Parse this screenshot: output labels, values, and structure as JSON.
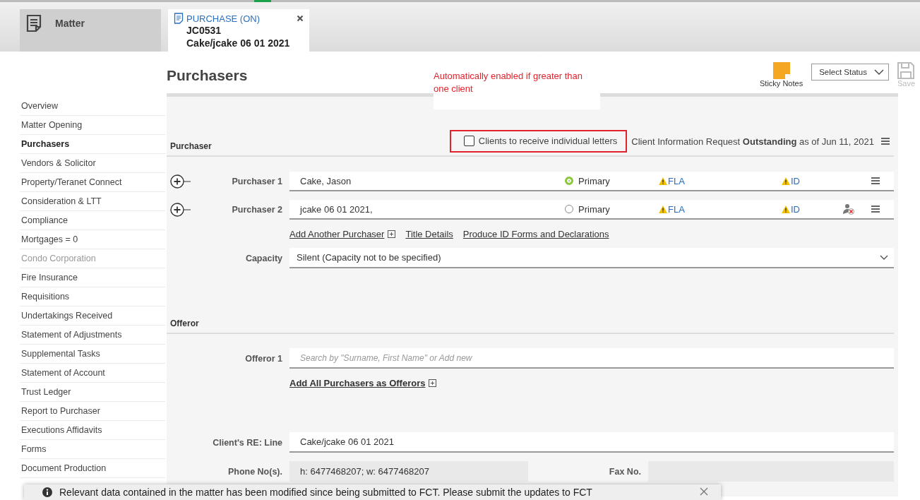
{
  "header": {
    "module": "Matter",
    "tab": {
      "type": "PURCHASE (ON)",
      "number": "JC0531",
      "name": "Cake/jcake 06 01 2021"
    }
  },
  "page_title": "Purchasers",
  "annotation": "Automatically enabled if greater than one client",
  "toolbar": {
    "sticky_notes": "Sticky Notes",
    "status_select": "Select Status",
    "save": {
      "label": "Save",
      "disabled": true
    }
  },
  "sidebar": [
    {
      "label": "Overview",
      "selected": false,
      "disabled": false
    },
    {
      "label": "Matter Opening",
      "selected": false,
      "disabled": false
    },
    {
      "label": "Purchasers",
      "selected": true,
      "disabled": false
    },
    {
      "label": "Vendors & Solicitor",
      "selected": false,
      "disabled": false
    },
    {
      "label": "Property/Teranet Connect",
      "selected": false,
      "disabled": false
    },
    {
      "label": "Consideration & LTT",
      "selected": false,
      "disabled": false
    },
    {
      "label": "Compliance",
      "selected": false,
      "disabled": false
    },
    {
      "label": "Mortgages = 0",
      "selected": false,
      "disabled": false
    },
    {
      "label": "Condo Corporation",
      "selected": false,
      "disabled": true
    },
    {
      "label": "Fire Insurance",
      "selected": false,
      "disabled": false
    },
    {
      "label": "Requisitions",
      "selected": false,
      "disabled": false
    },
    {
      "label": "Undertakings Received",
      "selected": false,
      "disabled": false
    },
    {
      "label": "Statement of Adjustments",
      "selected": false,
      "disabled": false
    },
    {
      "label": "Supplemental Tasks",
      "selected": false,
      "disabled": false
    },
    {
      "label": "Statement of Account",
      "selected": false,
      "disabled": false
    },
    {
      "label": "Trust Ledger",
      "selected": false,
      "disabled": false
    },
    {
      "label": "Report to Purchaser",
      "selected": false,
      "disabled": false
    },
    {
      "label": "Executions Affidavits",
      "selected": false,
      "disabled": false
    },
    {
      "label": "Forms",
      "selected": false,
      "disabled": false
    },
    {
      "label": "Document Production",
      "selected": false,
      "disabled": false
    }
  ],
  "purchaser_section": {
    "title": "Purchaser",
    "individual_letters": {
      "label": "Clients to receive individual letters",
      "checked": false
    },
    "info_request": "Client Information Request **Outstanding** as of Jun 11, 2021",
    "purchasers": [
      {
        "label": "Purchaser 1",
        "name": "Cake, Jason",
        "primary": true,
        "primary_label": "Primary",
        "fla": "FLA",
        "id": "ID",
        "unlinked": false
      },
      {
        "label": "Purchaser 2",
        "name": "jcake 06 01 2021,",
        "primary": false,
        "primary_label": "Primary",
        "fla": "FLA",
        "id": "ID",
        "unlinked": true
      }
    ],
    "links": [
      {
        "label": "Add Another Purchaser",
        "kind": "add"
      },
      {
        "label": "Title Details",
        "kind": "plain"
      },
      {
        "label": "Produce ID Forms and Declarations",
        "kind": "plain"
      }
    ],
    "capacity": {
      "label": "Capacity",
      "value": "Silent (Capacity not to be specified)"
    }
  },
  "offeror_section": {
    "title": "Offeror",
    "offerors": [
      {
        "label": "Offeror 1",
        "placeholder": "Search by \"Surname, First Name\" or Add new"
      }
    ],
    "link": {
      "label": "Add All Purchasers as Offerors",
      "kind": "add"
    }
  },
  "re_line": {
    "label": "Client's RE: Line",
    "value": "Cake/jcake 06 01 2021"
  },
  "phone": {
    "label": "Phone No(s).",
    "value": "h: 6477468207; w: 6477468207"
  },
  "fax": {
    "label": "Fax No."
  },
  "notice": "Relevant data contained in the matter has been modified since being submitted to FCT. Please submit the updates to FCT"
}
